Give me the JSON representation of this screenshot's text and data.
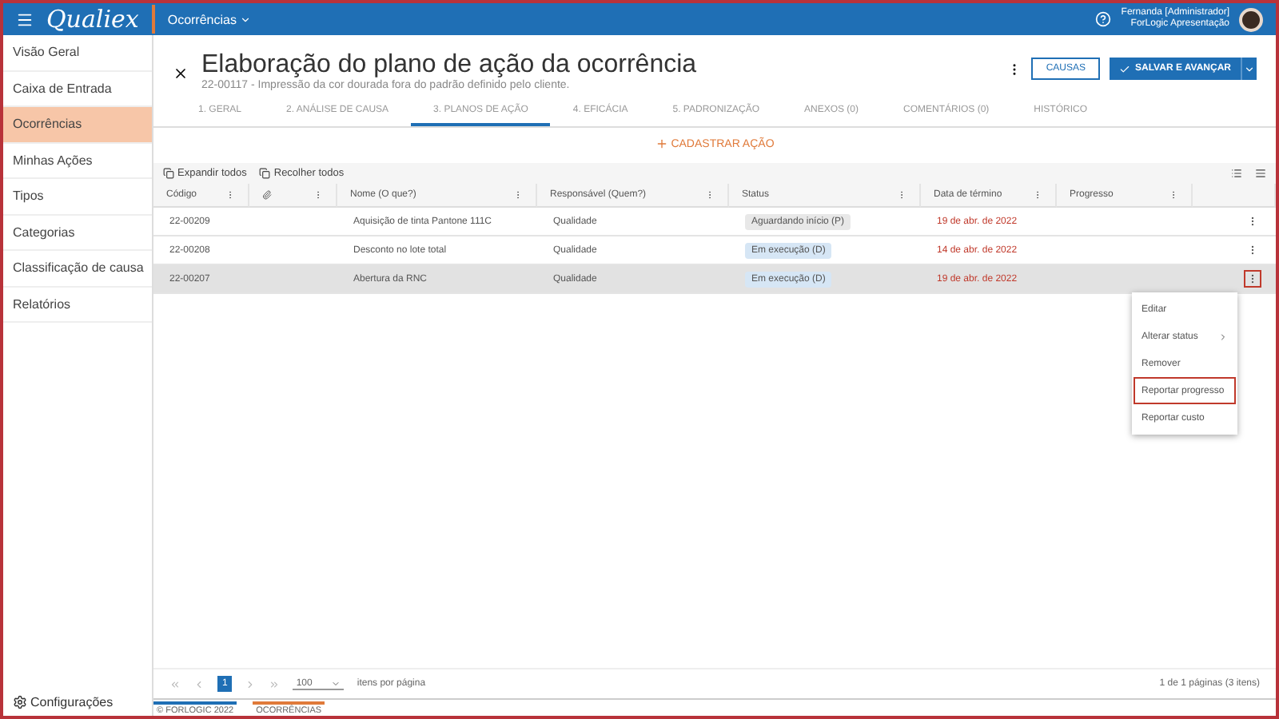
{
  "topbar": {
    "logo": "Qualiex",
    "module": "Ocorrências",
    "user_name": "Fernanda [Administrador]",
    "user_org": "ForLogic Apresentação"
  },
  "sidebar": {
    "items": [
      {
        "label": "Visão Geral",
        "selected": false
      },
      {
        "label": "Caixa de Entrada",
        "selected": false
      },
      {
        "label": "Ocorrências",
        "selected": true
      },
      {
        "label": "Minhas Ações",
        "selected": false
      },
      {
        "label": "Tipos",
        "selected": false
      },
      {
        "label": "Categorias",
        "selected": false
      },
      {
        "label": "Classificação de causa",
        "selected": false
      },
      {
        "label": "Relatórios",
        "selected": false
      }
    ],
    "settings": "Configurações"
  },
  "header": {
    "title": "Elaboração do plano de ação da ocorrência",
    "subtitle": "22-00117 - Impressão da cor dourada fora do padrão definido pelo cliente.",
    "causes_button": "CAUSAS",
    "save_button": "SALVAR E AVANÇAR"
  },
  "tabs": [
    {
      "label": "1. GERAL",
      "selected": false
    },
    {
      "label": "2. ANÁLISE DE CAUSA",
      "selected": false
    },
    {
      "label": "3. PLANOS DE AÇÃO",
      "selected": true
    },
    {
      "label": "4. EFICÁCIA",
      "selected": false
    },
    {
      "label": "5. PADRONIZAÇÃO",
      "selected": false
    },
    {
      "label": "ANEXOS (0)",
      "selected": false
    },
    {
      "label": "COMENTÁRIOS (0)",
      "selected": false
    },
    {
      "label": "HISTÓRICO",
      "selected": false
    }
  ],
  "add_action": "CADASTRAR AÇÃO",
  "toolbar": {
    "expand": "Expandir todos",
    "collapse": "Recolher todos"
  },
  "table": {
    "columns": [
      "Código",
      "",
      "Nome (O que?)",
      "Responsável (Quem?)",
      "Status",
      "Data de término",
      "Progresso"
    ],
    "rows": [
      {
        "code": "22-00209",
        "name": "Aquisição de tinta Pantone 111C",
        "owner": "Qualidade",
        "status": "Aguardando início (P)",
        "color": "#e8e8e8",
        "due": "19 de abr. de 2022",
        "selected": false,
        "menu_highlighted": false
      },
      {
        "code": "22-00208",
        "name": "Desconto no lote total",
        "owner": "Qualidade",
        "status": "Em execução (D)",
        "color": "#d6e6f5",
        "due": "14 de abr. de 2022",
        "selected": false,
        "menu_highlighted": false
      },
      {
        "code": "22-00207",
        "name": "Abertura da RNC",
        "owner": "Qualidade",
        "status": "Em execução (D)",
        "color": "#d6e6f5",
        "due": "19 de abr. de 2022",
        "selected": true,
        "menu_highlighted": true
      }
    ]
  },
  "context_menu": [
    {
      "label": "Editar",
      "submenu": false,
      "highlighted": false
    },
    {
      "label": "Alterar status",
      "submenu": true,
      "highlighted": false
    },
    {
      "label": "Remover",
      "submenu": false,
      "highlighted": false
    },
    {
      "label": "Reportar progresso",
      "submenu": false,
      "highlighted": true
    },
    {
      "label": "Reportar custo",
      "submenu": false,
      "highlighted": false
    }
  ],
  "pagination": {
    "page": "1",
    "page_size": "100",
    "page_size_label": "itens por página",
    "summary": "1 de 1 páginas (3 itens)"
  },
  "footer": {
    "copyright": "© FORLOGIC 2022",
    "module": "OCORRÊNCIAS"
  }
}
